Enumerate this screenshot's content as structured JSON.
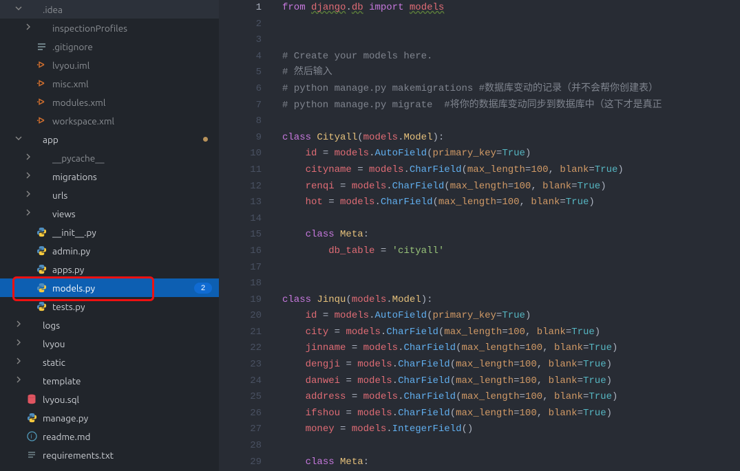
{
  "sidebar": {
    "items": [
      {
        "indent": 14,
        "chev": "down",
        "icon": "folder",
        "label": ".idea",
        "dim": true
      },
      {
        "indent": 28,
        "chev": "right",
        "icon": "folder",
        "label": "inspectionProfiles",
        "dim": true
      },
      {
        "indent": 28,
        "chev": "",
        "icon": "gitignore",
        "label": ".gitignore",
        "dim": true
      },
      {
        "indent": 28,
        "chev": "",
        "icon": "xml",
        "label": "lvyou.iml",
        "dim": true
      },
      {
        "indent": 28,
        "chev": "",
        "icon": "xml",
        "label": "misc.xml",
        "dim": true
      },
      {
        "indent": 28,
        "chev": "",
        "icon": "xml",
        "label": "modules.xml",
        "dim": true
      },
      {
        "indent": 28,
        "chev": "",
        "icon": "xml",
        "label": "workspace.xml",
        "dim": true
      },
      {
        "indent": 14,
        "chev": "down",
        "icon": "folder",
        "label": "app",
        "dot": true
      },
      {
        "indent": 28,
        "chev": "right",
        "icon": "folder",
        "label": "__pycache__",
        "dim": true
      },
      {
        "indent": 28,
        "chev": "right",
        "icon": "folder",
        "label": "migrations"
      },
      {
        "indent": 28,
        "chev": "right",
        "icon": "folder",
        "label": "urls"
      },
      {
        "indent": 28,
        "chev": "right",
        "icon": "folder",
        "label": "views"
      },
      {
        "indent": 28,
        "chev": "",
        "icon": "python",
        "label": "__init__.py"
      },
      {
        "indent": 28,
        "chev": "",
        "icon": "python",
        "label": "admin.py"
      },
      {
        "indent": 28,
        "chev": "",
        "icon": "python",
        "label": "apps.py"
      },
      {
        "indent": 28,
        "chev": "",
        "icon": "python",
        "label": "models.py",
        "selected": true,
        "badge": "2",
        "highlight": true
      },
      {
        "indent": 28,
        "chev": "",
        "icon": "python",
        "label": "tests.py"
      },
      {
        "indent": 14,
        "chev": "right",
        "icon": "folder",
        "label": "logs"
      },
      {
        "indent": 14,
        "chev": "right",
        "icon": "folder",
        "label": "lvyou"
      },
      {
        "indent": 14,
        "chev": "right",
        "icon": "folder",
        "label": "static"
      },
      {
        "indent": 14,
        "chev": "right",
        "icon": "folder",
        "label": "template"
      },
      {
        "indent": 14,
        "chev": "",
        "icon": "db",
        "label": "lvyou.sql"
      },
      {
        "indent": 14,
        "chev": "",
        "icon": "python",
        "label": "manage.py"
      },
      {
        "indent": 14,
        "chev": "",
        "icon": "md",
        "label": "readme.md"
      },
      {
        "indent": 14,
        "chev": "",
        "icon": "txt",
        "label": "requirements.txt"
      }
    ]
  },
  "editor": {
    "active_line": 1,
    "lines": [
      {
        "n": 1,
        "tokens": [
          [
            "kw",
            "from"
          ],
          [
            "op",
            " "
          ],
          [
            "squig id",
            "django"
          ],
          [
            "op",
            "."
          ],
          [
            "squig id",
            "db"
          ],
          [
            "op",
            " "
          ],
          [
            "kw",
            "import"
          ],
          [
            "op",
            " "
          ],
          [
            "squig id",
            "models"
          ]
        ]
      },
      {
        "n": 2,
        "tokens": []
      },
      {
        "n": 3,
        "tokens": []
      },
      {
        "n": 4,
        "tokens": [
          [
            "cmt",
            "# Create your models here."
          ]
        ]
      },
      {
        "n": 5,
        "tokens": [
          [
            "cmt",
            "# 然后输入"
          ]
        ]
      },
      {
        "n": 6,
        "tokens": [
          [
            "cmt",
            "# python manage.py makemigrations #数据库变动的记录（并不会帮你创建表）"
          ]
        ]
      },
      {
        "n": 7,
        "tokens": [
          [
            "cmt",
            "# python manage.py migrate  #将你的数据库变动同步到数据库中（这下才是真正"
          ]
        ]
      },
      {
        "n": 8,
        "tokens": []
      },
      {
        "n": 9,
        "tokens": [
          [
            "kw",
            "class"
          ],
          [
            "op",
            " "
          ],
          [
            "cls",
            "Cityall"
          ],
          [
            "op",
            "("
          ],
          [
            "id",
            "models"
          ],
          [
            "op",
            "."
          ],
          [
            "cls",
            "Model"
          ],
          [
            "op",
            ")"
          ],
          [
            "op",
            ":"
          ]
        ]
      },
      {
        "n": 10,
        "tokens": [
          [
            "op",
            "    "
          ],
          [
            "id",
            "id"
          ],
          [
            "op",
            " "
          ],
          [
            "op",
            "="
          ],
          [
            "op",
            " "
          ],
          [
            "id",
            "models"
          ],
          [
            "op",
            "."
          ],
          [
            "fn",
            "AutoField"
          ],
          [
            "op",
            "("
          ],
          [
            "prm",
            "primary_key"
          ],
          [
            "op",
            "="
          ],
          [
            "bl",
            "True"
          ],
          [
            "op",
            ")"
          ]
        ]
      },
      {
        "n": 11,
        "tokens": [
          [
            "op",
            "    "
          ],
          [
            "id",
            "cityname"
          ],
          [
            "op",
            " "
          ],
          [
            "op",
            "="
          ],
          [
            "op",
            " "
          ],
          [
            "id",
            "models"
          ],
          [
            "op",
            "."
          ],
          [
            "fn",
            "CharField"
          ],
          [
            "op",
            "("
          ],
          [
            "prm",
            "max_length"
          ],
          [
            "op",
            "="
          ],
          [
            "num",
            "100"
          ],
          [
            "op",
            ", "
          ],
          [
            "prm",
            "blank"
          ],
          [
            "op",
            "="
          ],
          [
            "bl",
            "True"
          ],
          [
            "op",
            ")"
          ]
        ]
      },
      {
        "n": 12,
        "tokens": [
          [
            "op",
            "    "
          ],
          [
            "id",
            "renqi"
          ],
          [
            "op",
            " "
          ],
          [
            "op",
            "="
          ],
          [
            "op",
            " "
          ],
          [
            "id",
            "models"
          ],
          [
            "op",
            "."
          ],
          [
            "fn",
            "CharField"
          ],
          [
            "op",
            "("
          ],
          [
            "prm",
            "max_length"
          ],
          [
            "op",
            "="
          ],
          [
            "num",
            "100"
          ],
          [
            "op",
            ", "
          ],
          [
            "prm",
            "blank"
          ],
          [
            "op",
            "="
          ],
          [
            "bl",
            "True"
          ],
          [
            "op",
            ")"
          ]
        ]
      },
      {
        "n": 13,
        "tokens": [
          [
            "op",
            "    "
          ],
          [
            "id",
            "hot"
          ],
          [
            "op",
            " "
          ],
          [
            "op",
            "="
          ],
          [
            "op",
            " "
          ],
          [
            "id",
            "models"
          ],
          [
            "op",
            "."
          ],
          [
            "fn",
            "CharField"
          ],
          [
            "op",
            "("
          ],
          [
            "prm",
            "max_length"
          ],
          [
            "op",
            "="
          ],
          [
            "num",
            "100"
          ],
          [
            "op",
            ", "
          ],
          [
            "prm",
            "blank"
          ],
          [
            "op",
            "="
          ],
          [
            "bl",
            "True"
          ],
          [
            "op",
            ")"
          ]
        ]
      },
      {
        "n": 14,
        "tokens": []
      },
      {
        "n": 15,
        "tokens": [
          [
            "op",
            "    "
          ],
          [
            "kw",
            "class"
          ],
          [
            "op",
            " "
          ],
          [
            "cls",
            "Meta"
          ],
          [
            "op",
            ":"
          ]
        ]
      },
      {
        "n": 16,
        "tokens": [
          [
            "op",
            "        "
          ],
          [
            "id",
            "db_table"
          ],
          [
            "op",
            " "
          ],
          [
            "op",
            "="
          ],
          [
            "op",
            " "
          ],
          [
            "str",
            "'cityall'"
          ]
        ]
      },
      {
        "n": 17,
        "tokens": []
      },
      {
        "n": 18,
        "tokens": []
      },
      {
        "n": 19,
        "tokens": [
          [
            "kw",
            "class"
          ],
          [
            "op",
            " "
          ],
          [
            "cls",
            "Jinqu"
          ],
          [
            "op",
            "("
          ],
          [
            "id",
            "models"
          ],
          [
            "op",
            "."
          ],
          [
            "cls",
            "Model"
          ],
          [
            "op",
            ")"
          ],
          [
            "op",
            ":"
          ]
        ]
      },
      {
        "n": 20,
        "tokens": [
          [
            "op",
            "    "
          ],
          [
            "id",
            "id"
          ],
          [
            "op",
            " "
          ],
          [
            "op",
            "="
          ],
          [
            "op",
            " "
          ],
          [
            "id",
            "models"
          ],
          [
            "op",
            "."
          ],
          [
            "fn",
            "AutoField"
          ],
          [
            "op",
            "("
          ],
          [
            "prm",
            "primary_key"
          ],
          [
            "op",
            "="
          ],
          [
            "bl",
            "True"
          ],
          [
            "op",
            ")"
          ]
        ]
      },
      {
        "n": 21,
        "tokens": [
          [
            "op",
            "    "
          ],
          [
            "id",
            "city"
          ],
          [
            "op",
            " "
          ],
          [
            "op",
            "="
          ],
          [
            "op",
            " "
          ],
          [
            "id",
            "models"
          ],
          [
            "op",
            "."
          ],
          [
            "fn",
            "CharField"
          ],
          [
            "op",
            "("
          ],
          [
            "prm",
            "max_length"
          ],
          [
            "op",
            "="
          ],
          [
            "num",
            "100"
          ],
          [
            "op",
            ", "
          ],
          [
            "prm",
            "blank"
          ],
          [
            "op",
            "="
          ],
          [
            "bl",
            "True"
          ],
          [
            "op",
            ")"
          ]
        ]
      },
      {
        "n": 22,
        "tokens": [
          [
            "op",
            "    "
          ],
          [
            "id",
            "jinname"
          ],
          [
            "op",
            " "
          ],
          [
            "op",
            "="
          ],
          [
            "op",
            " "
          ],
          [
            "id",
            "models"
          ],
          [
            "op",
            "."
          ],
          [
            "fn",
            "CharField"
          ],
          [
            "op",
            "("
          ],
          [
            "prm",
            "max_length"
          ],
          [
            "op",
            "="
          ],
          [
            "num",
            "100"
          ],
          [
            "op",
            ", "
          ],
          [
            "prm",
            "blank"
          ],
          [
            "op",
            "="
          ],
          [
            "bl",
            "True"
          ],
          [
            "op",
            ")"
          ]
        ]
      },
      {
        "n": 23,
        "tokens": [
          [
            "op",
            "    "
          ],
          [
            "id",
            "dengji"
          ],
          [
            "op",
            " "
          ],
          [
            "op",
            "="
          ],
          [
            "op",
            " "
          ],
          [
            "id",
            "models"
          ],
          [
            "op",
            "."
          ],
          [
            "fn",
            "CharField"
          ],
          [
            "op",
            "("
          ],
          [
            "prm",
            "max_length"
          ],
          [
            "op",
            "="
          ],
          [
            "num",
            "100"
          ],
          [
            "op",
            ", "
          ],
          [
            "prm",
            "blank"
          ],
          [
            "op",
            "="
          ],
          [
            "bl",
            "True"
          ],
          [
            "op",
            ")"
          ]
        ]
      },
      {
        "n": 24,
        "tokens": [
          [
            "op",
            "    "
          ],
          [
            "id",
            "danwei"
          ],
          [
            "op",
            " "
          ],
          [
            "op",
            "="
          ],
          [
            "op",
            " "
          ],
          [
            "id",
            "models"
          ],
          [
            "op",
            "."
          ],
          [
            "fn",
            "CharField"
          ],
          [
            "op",
            "("
          ],
          [
            "prm",
            "max_length"
          ],
          [
            "op",
            "="
          ],
          [
            "num",
            "100"
          ],
          [
            "op",
            ", "
          ],
          [
            "prm",
            "blank"
          ],
          [
            "op",
            "="
          ],
          [
            "bl",
            "True"
          ],
          [
            "op",
            ")"
          ]
        ]
      },
      {
        "n": 25,
        "tokens": [
          [
            "op",
            "    "
          ],
          [
            "id",
            "address"
          ],
          [
            "op",
            " "
          ],
          [
            "op",
            "="
          ],
          [
            "op",
            " "
          ],
          [
            "id",
            "models"
          ],
          [
            "op",
            "."
          ],
          [
            "fn",
            "CharField"
          ],
          [
            "op",
            "("
          ],
          [
            "prm",
            "max_length"
          ],
          [
            "op",
            "="
          ],
          [
            "num",
            "100"
          ],
          [
            "op",
            ", "
          ],
          [
            "prm",
            "blank"
          ],
          [
            "op",
            "="
          ],
          [
            "bl",
            "True"
          ],
          [
            "op",
            ")"
          ]
        ]
      },
      {
        "n": 26,
        "tokens": [
          [
            "op",
            "    "
          ],
          [
            "id",
            "ifshou"
          ],
          [
            "op",
            " "
          ],
          [
            "op",
            "="
          ],
          [
            "op",
            " "
          ],
          [
            "id",
            "models"
          ],
          [
            "op",
            "."
          ],
          [
            "fn",
            "CharField"
          ],
          [
            "op",
            "("
          ],
          [
            "prm",
            "max_length"
          ],
          [
            "op",
            "="
          ],
          [
            "num",
            "100"
          ],
          [
            "op",
            ", "
          ],
          [
            "prm",
            "blank"
          ],
          [
            "op",
            "="
          ],
          [
            "bl",
            "True"
          ],
          [
            "op",
            ")"
          ]
        ]
      },
      {
        "n": 27,
        "tokens": [
          [
            "op",
            "    "
          ],
          [
            "id",
            "money"
          ],
          [
            "op",
            " "
          ],
          [
            "op",
            "="
          ],
          [
            "op",
            " "
          ],
          [
            "id",
            "models"
          ],
          [
            "op",
            "."
          ],
          [
            "fn",
            "IntegerField"
          ],
          [
            "op",
            "("
          ],
          [
            "op",
            ")"
          ]
        ]
      },
      {
        "n": 28,
        "tokens": []
      },
      {
        "n": 29,
        "tokens": [
          [
            "op",
            "    "
          ],
          [
            "kw",
            "class"
          ],
          [
            "op",
            " "
          ],
          [
            "cls",
            "Meta"
          ],
          [
            "op",
            ":"
          ]
        ]
      }
    ]
  }
}
